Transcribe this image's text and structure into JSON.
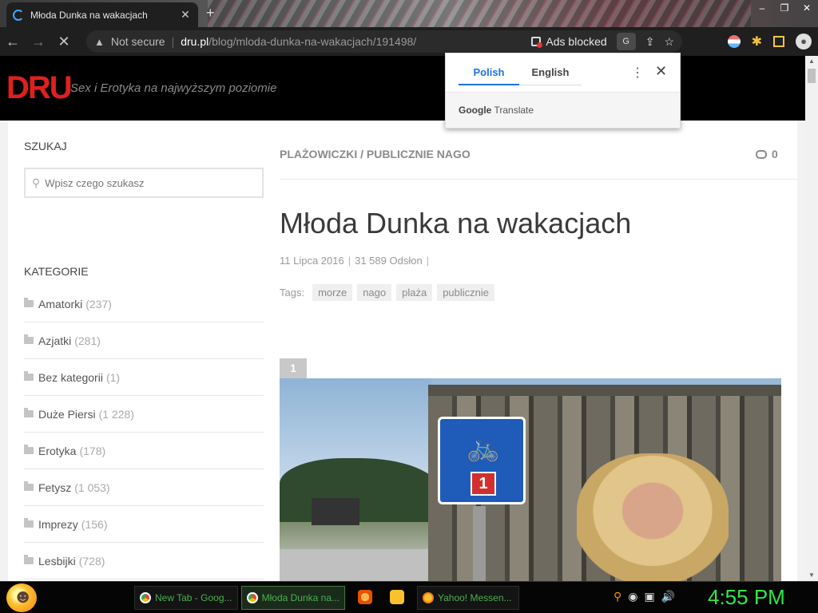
{
  "browser": {
    "tab_title": "Młoda Dunka na wakacjach",
    "tab_close": "✕",
    "new_tab": "+",
    "window_controls": [
      "‒",
      "❐",
      "✕"
    ],
    "nav": {
      "back": "←",
      "forward": "→",
      "stop": "✕"
    },
    "address": {
      "warning_icon": "▲",
      "security_label": "Not secure",
      "host": "dru.pl",
      "path": "/blog/mloda-dunka-na-wakacjach/191498/"
    },
    "ads_blocked_label": "Ads blocked",
    "translate_icon_text": "G",
    "share_icon": "⇪",
    "bookmark_icon": "☆",
    "extensions_icon": "✱",
    "profile_icon": "●"
  },
  "translate_popup": {
    "tabs": [
      "Polish",
      "English"
    ],
    "active_tab": 0,
    "kebab": "⋮",
    "close": "✕",
    "brand_google": "Google",
    "brand_translate": "Translate"
  },
  "site": {
    "logo": "DRU",
    "tagline": "Sex i Erotyka na najwyższym poziomie"
  },
  "sidebar": {
    "search_heading": "SZUKAJ",
    "search_placeholder": "Wpisz czego szukasz",
    "categories_heading": "KATEGORIE",
    "categories": [
      {
        "name": "Amatorki",
        "count": "(237)"
      },
      {
        "name": "Azjatki",
        "count": "(281)"
      },
      {
        "name": "Bez kategorii",
        "count": "(1)"
      },
      {
        "name": "Duże Piersi",
        "count": "(1 228)"
      },
      {
        "name": "Erotyka",
        "count": "(178)"
      },
      {
        "name": "Fetysz",
        "count": "(1 053)"
      },
      {
        "name": "Imprezy",
        "count": "(156)"
      },
      {
        "name": "Lesbijki",
        "count": "(728)"
      }
    ]
  },
  "post": {
    "category_line": "PLAŻOWICZKI / PUBLICZNIE NAGO",
    "comment_count": "0",
    "title": "Młoda Dunka na wakacjach",
    "date": "11 Lipca 2016",
    "views": "31 589 Odsłon",
    "meta_sep": "|",
    "tags_label": "Tags:",
    "tags": [
      "morze",
      "nago",
      "plaża",
      "publicznie"
    ],
    "image_number": "1",
    "sign_number": "1",
    "sign_bike": "🚲"
  },
  "scrollbar": {
    "up": "▲",
    "down": "▼"
  },
  "taskbar": {
    "tasks": [
      {
        "label": "New Tab - Goog...",
        "active": false
      },
      {
        "label": "Młoda Dunka na...",
        "active": true
      },
      {
        "label": "Yahoo! Messen...",
        "active": false
      }
    ],
    "tray_icons": [
      "⚲",
      "◉",
      "▣",
      "🔊"
    ],
    "clock": "4:55 PM"
  }
}
